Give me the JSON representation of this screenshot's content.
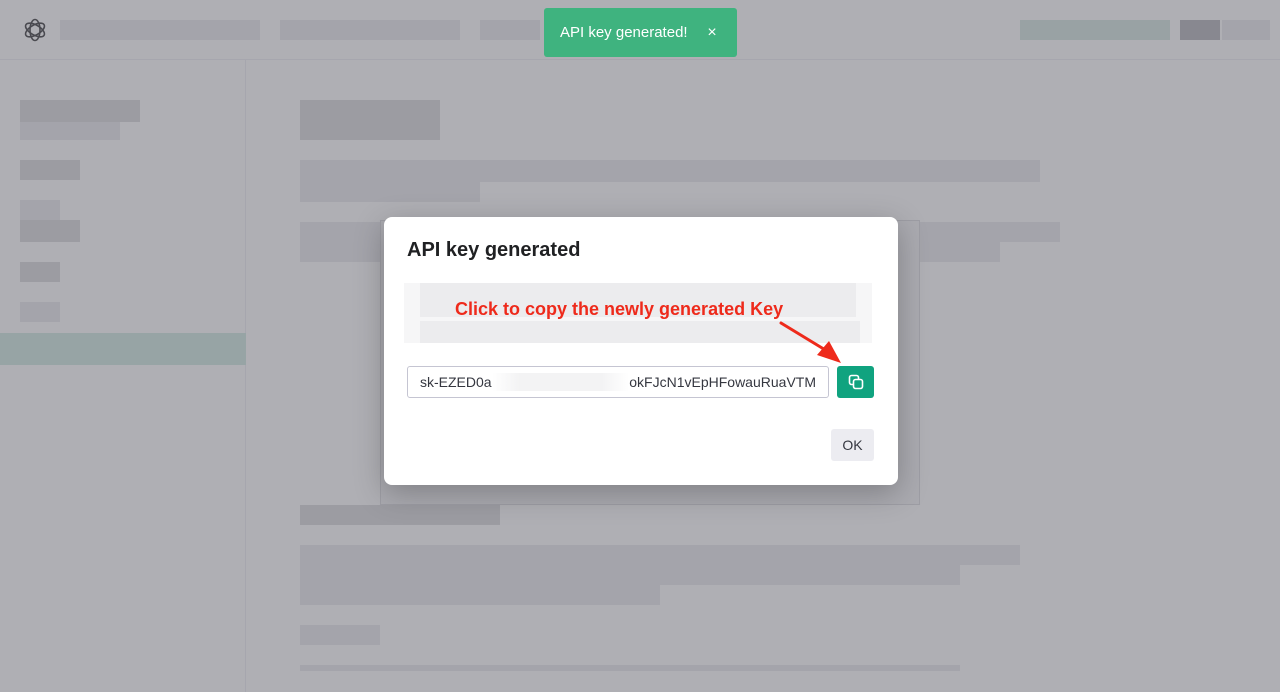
{
  "toast": {
    "message": "API key generated!",
    "close_glyph": "×",
    "color": "#3fb37f"
  },
  "modal": {
    "title": "API key generated",
    "annotation": "Click to copy the newly generated Key",
    "annotation_color": "#ee2a1b",
    "key_prefix": "sk-EZED0a",
    "key_suffix": "okFJcN1vEpHFowauRuaVTM",
    "copy_icon": "copy-icon",
    "copy_color": "#10a37f",
    "ok_label": "OK"
  }
}
